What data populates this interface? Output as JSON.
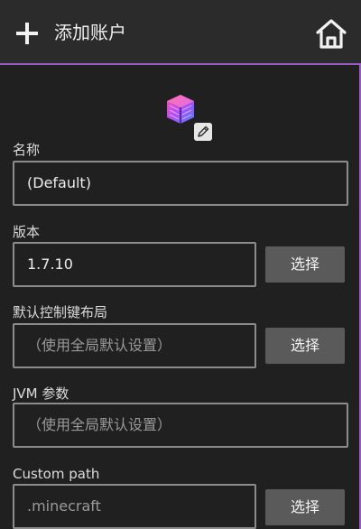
{
  "toolbar": {
    "title": "添加账户"
  },
  "form": {
    "name": {
      "label": "名称",
      "value": "(Default)"
    },
    "version": {
      "label": "版本",
      "value": "1.7.10",
      "button": "选择"
    },
    "control_layout": {
      "label": "默认控制键布局",
      "placeholder": "（使用全局默认设置）",
      "button": "选择"
    },
    "jvm_args": {
      "label": "JVM 参数",
      "placeholder": "（使用全局默认设置）"
    },
    "custom_path": {
      "label": "Custom path",
      "placeholder": ".minecraft",
      "button": "选择"
    }
  },
  "colors": {
    "accent": "#9b59c7",
    "background": "#202020",
    "toolbar": "#2b2b2b",
    "button": "#5a5a5a"
  },
  "icons": {
    "add": "plus-icon",
    "home": "home-icon",
    "profile": "cube-icon",
    "edit": "pencil-icon"
  }
}
